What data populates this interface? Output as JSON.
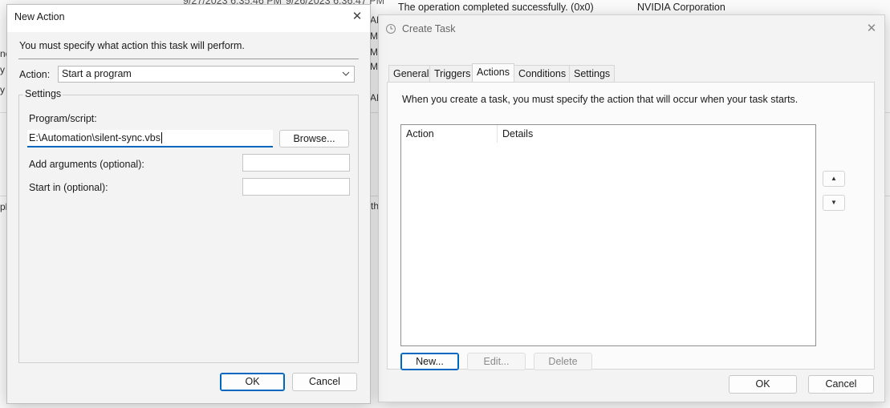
{
  "background": {
    "status_text": "The operation completed successfully. (0x0)",
    "author_text": "NVIDIA Corporation",
    "date_left": "9/27/2023 6:35:46 PM",
    "date_right": "9/26/2023 6:36:47 PM",
    "frag_m1": "M",
    "frag_am1": "AM",
    "frag_m2": "M",
    "frag_m3": "M",
    "frag_am2": "AM",
    "frag_th": "th",
    "frag_left": [
      "nc",
      "y",
      "y",
      "pl"
    ]
  },
  "new_action": {
    "title": "New Action",
    "instruction": "You must specify what action this task will perform.",
    "action_label": "Action:",
    "action_value": "Start a program",
    "settings_label": "Settings",
    "program_label": "Program/script:",
    "program_value": "E:\\Automation\\silent-sync.vbs",
    "browse_label": "Browse...",
    "args_label": "Add arguments (optional):",
    "args_value": "",
    "startin_label": "Start in (optional):",
    "startin_value": "",
    "ok_label": "OK",
    "cancel_label": "Cancel"
  },
  "create_task": {
    "title": "Create Task",
    "tabs": [
      "General",
      "Triggers",
      "Actions",
      "Conditions",
      "Settings"
    ],
    "selected_tab": "Actions",
    "description": "When you create a task, you must specify the action that will occur when your task starts.",
    "columns": [
      "Action",
      "Details"
    ],
    "new_label": "New...",
    "edit_label": "Edit...",
    "delete_label": "Delete",
    "ok_label": "OK",
    "cancel_label": "Cancel"
  },
  "colors": {
    "accent": "#0067c0",
    "window_bg": "#f3f3f3"
  }
}
